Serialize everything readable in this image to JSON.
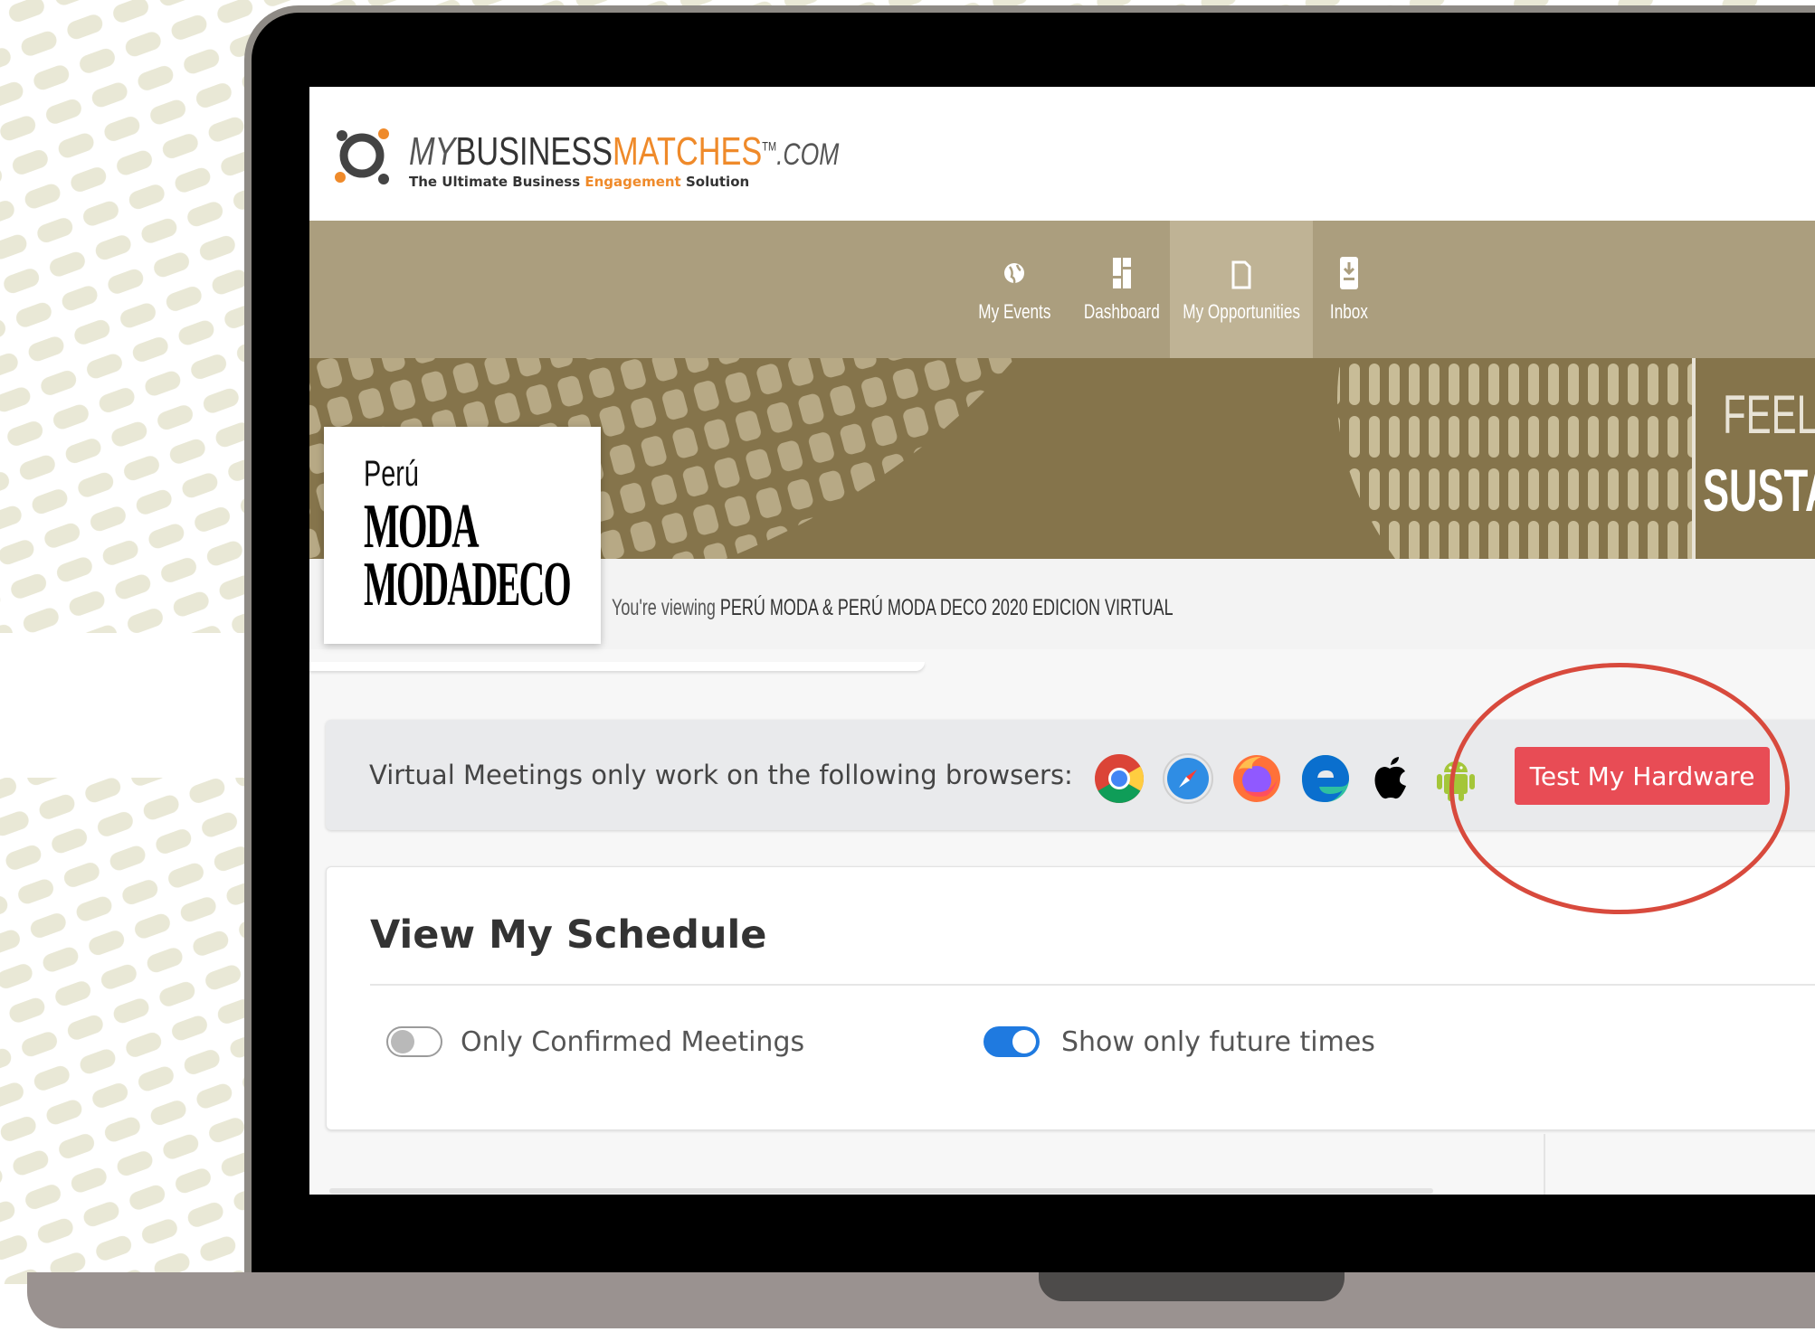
{
  "header": {
    "logo": {
      "word_my": "MY",
      "word_business": "BUSINESS",
      "word_matches": "MATCHES",
      "word_com": ".COM",
      "trademark": "TM",
      "tagline_start": "The Ultimate Business ",
      "tagline_highlight": "Engagement",
      "tagline_end": " Solution"
    }
  },
  "nav": {
    "items": [
      {
        "label": "My Events",
        "icon": "globe-icon"
      },
      {
        "label": "Dashboard",
        "icon": "dashboard-icon"
      },
      {
        "label": "My Opportunities",
        "icon": "document-icon",
        "active": true
      },
      {
        "label": "Inbox",
        "icon": "inbox-icon"
      }
    ]
  },
  "banner": {
    "text_line1": "FEEL &",
    "text_line2": "SUSTAI"
  },
  "event": {
    "logo_line1": "Perú",
    "logo_line2": "MODA",
    "logo_line3": "MODADECO",
    "viewing_prefix": "You're viewing ",
    "viewing_name": "PERÚ MODA & PERÚ MODA DECO 2020 EDICION VIRTUAL"
  },
  "browsers": {
    "message": "Virtual Meetings only work on the following browsers:",
    "icons": [
      "chrome-icon",
      "safari-icon",
      "firefox-icon",
      "edge-icon",
      "apple-icon",
      "android-icon"
    ],
    "test_button": "Test My Hardware"
  },
  "schedule": {
    "title": "View My Schedule",
    "toggles": [
      {
        "label": "Only Confirmed Meetings",
        "on": false
      },
      {
        "label": "Show only future times",
        "on": true
      }
    ]
  },
  "colors": {
    "nav_bg": "#ab9e7e",
    "nav_active": "#bfb395",
    "banner_bg": "#85744b",
    "accent_orange": "#ef8a2a",
    "button_red": "#e84c55",
    "toggle_blue": "#1f7ae0",
    "highlight_ring": "#d84a3d"
  }
}
